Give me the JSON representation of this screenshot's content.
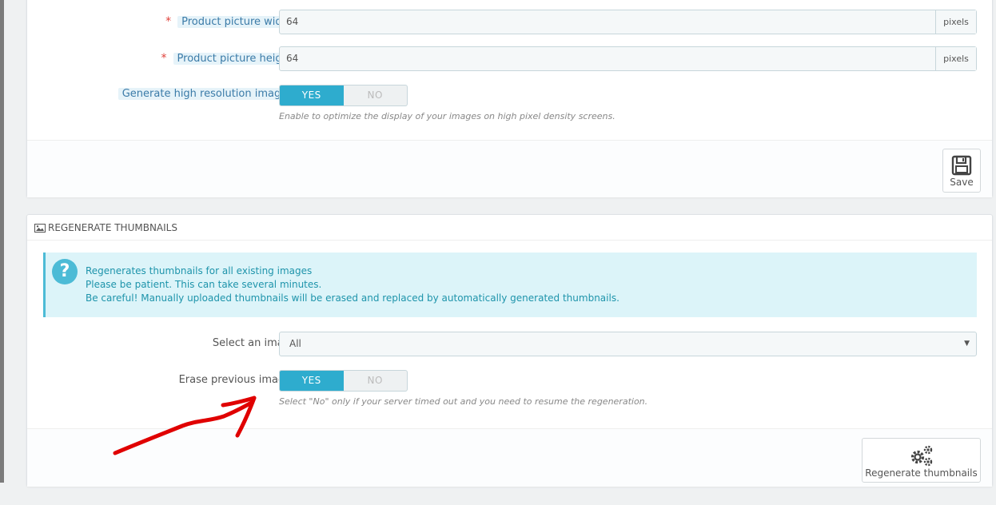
{
  "settings": {
    "width_label": "Product picture width",
    "width_value": "64",
    "width_unit": "pixels",
    "height_label": "Product picture height",
    "height_value": "64",
    "height_unit": "pixels",
    "hires_label": "Generate high resolution images",
    "hires_yes": "YES",
    "hires_no": "NO",
    "hires_help": "Enable to optimize the display of your images on high pixel density screens.",
    "save_label": "Save"
  },
  "regen": {
    "heading": "REGENERATE THUMBNAILS",
    "alert_lines": [
      "Regenerates thumbnails for all existing images",
      "Please be patient. This can take several minutes.",
      "Be careful! Manually uploaded thumbnails will be erased and replaced by automatically generated thumbnails."
    ],
    "select_label": "Select an image",
    "select_value": "All",
    "erase_label": "Erase previous images",
    "erase_yes": "YES",
    "erase_no": "NO",
    "erase_help": "Select \"No\" only if your server timed out and you need to resume the regeneration.",
    "button_label": "Regenerate thumbnails"
  },
  "colors": {
    "accent": "#2eacce",
    "annotation": "#e00000"
  }
}
